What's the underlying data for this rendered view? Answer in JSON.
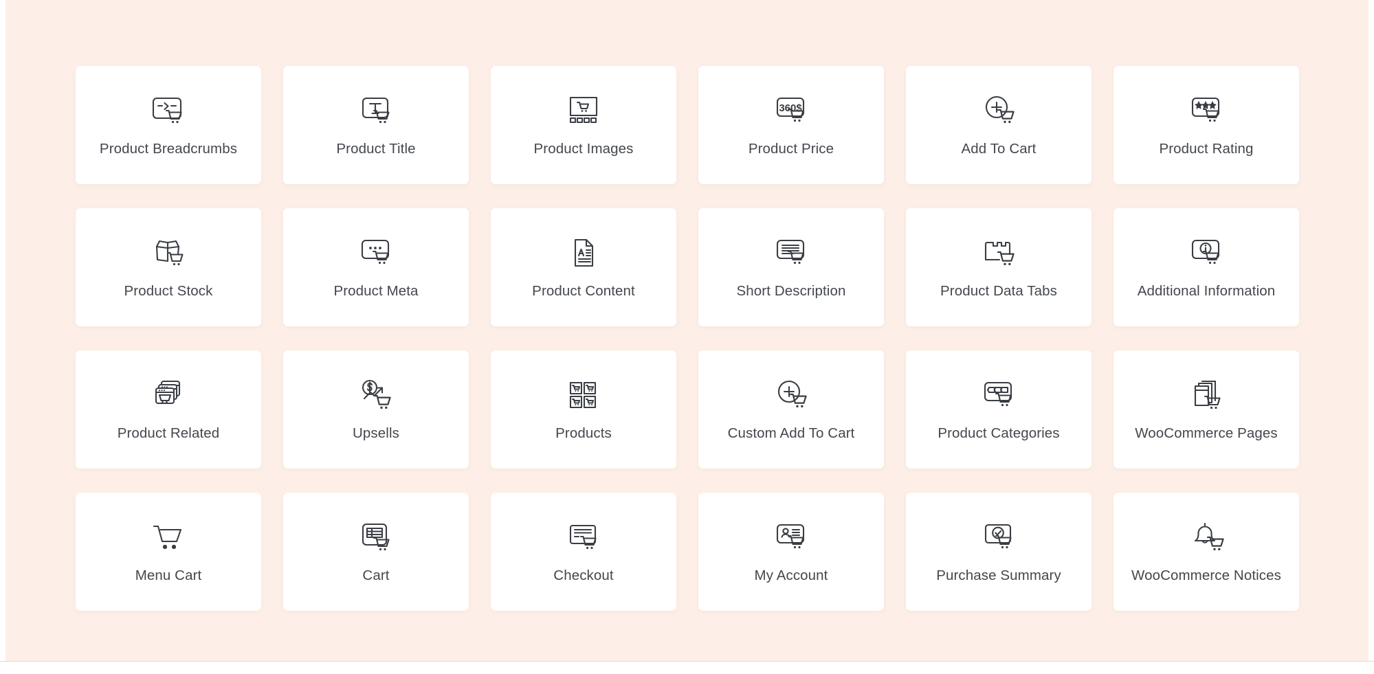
{
  "page": {
    "background_color": "#fdefe7",
    "card_background_color": "#ffffff",
    "icon_color": "#3a3e44",
    "label_color": "#43474d"
  },
  "grid": {
    "columns": 6,
    "rows": 4,
    "cards": [
      {
        "label": "Product Breadcrumbs",
        "icon": "breadcrumbs-cart-icon"
      },
      {
        "label": "Product Title",
        "icon": "title-cart-icon"
      },
      {
        "label": "Product Images",
        "icon": "gallery-cart-icon"
      },
      {
        "label": "Product Price",
        "icon": "price-tag-cart-icon",
        "price_text": "360$"
      },
      {
        "label": "Add To Cart",
        "icon": "plus-circle-cart-icon"
      },
      {
        "label": "Product Rating",
        "icon": "stars-cart-icon"
      },
      {
        "label": "Product Stock",
        "icon": "open-box-cart-icon"
      },
      {
        "label": "Product Meta",
        "icon": "meta-dots-cart-icon"
      },
      {
        "label": "Product Content",
        "icon": "document-text-icon"
      },
      {
        "label": "Short Description",
        "icon": "text-lines-cart-icon"
      },
      {
        "label": "Product Data Tabs",
        "icon": "folder-tabs-cart-icon"
      },
      {
        "label": "Additional Information",
        "icon": "info-circle-cart-icon"
      },
      {
        "label": "Product Related",
        "icon": "stacked-windows-cart-icon"
      },
      {
        "label": "Upsells",
        "icon": "dollar-trend-cart-icon"
      },
      {
        "label": "Products",
        "icon": "product-grid-icon"
      },
      {
        "label": "Custom Add To Cart",
        "icon": "plus-circle-cart-icon"
      },
      {
        "label": "Product Categories",
        "icon": "categories-tags-cart-icon"
      },
      {
        "label": "WooCommerce Pages",
        "icon": "pages-stack-cart-icon"
      },
      {
        "label": "Menu Cart",
        "icon": "shopping-cart-icon"
      },
      {
        "label": "Cart",
        "icon": "cart-table-cart-icon"
      },
      {
        "label": "Checkout",
        "icon": "credit-card-cart-icon"
      },
      {
        "label": "My Account",
        "icon": "user-card-cart-icon"
      },
      {
        "label": "Purchase Summary",
        "icon": "check-circle-cart-icon"
      },
      {
        "label": "WooCommerce Notices",
        "icon": "bell-cart-icon"
      }
    ]
  }
}
